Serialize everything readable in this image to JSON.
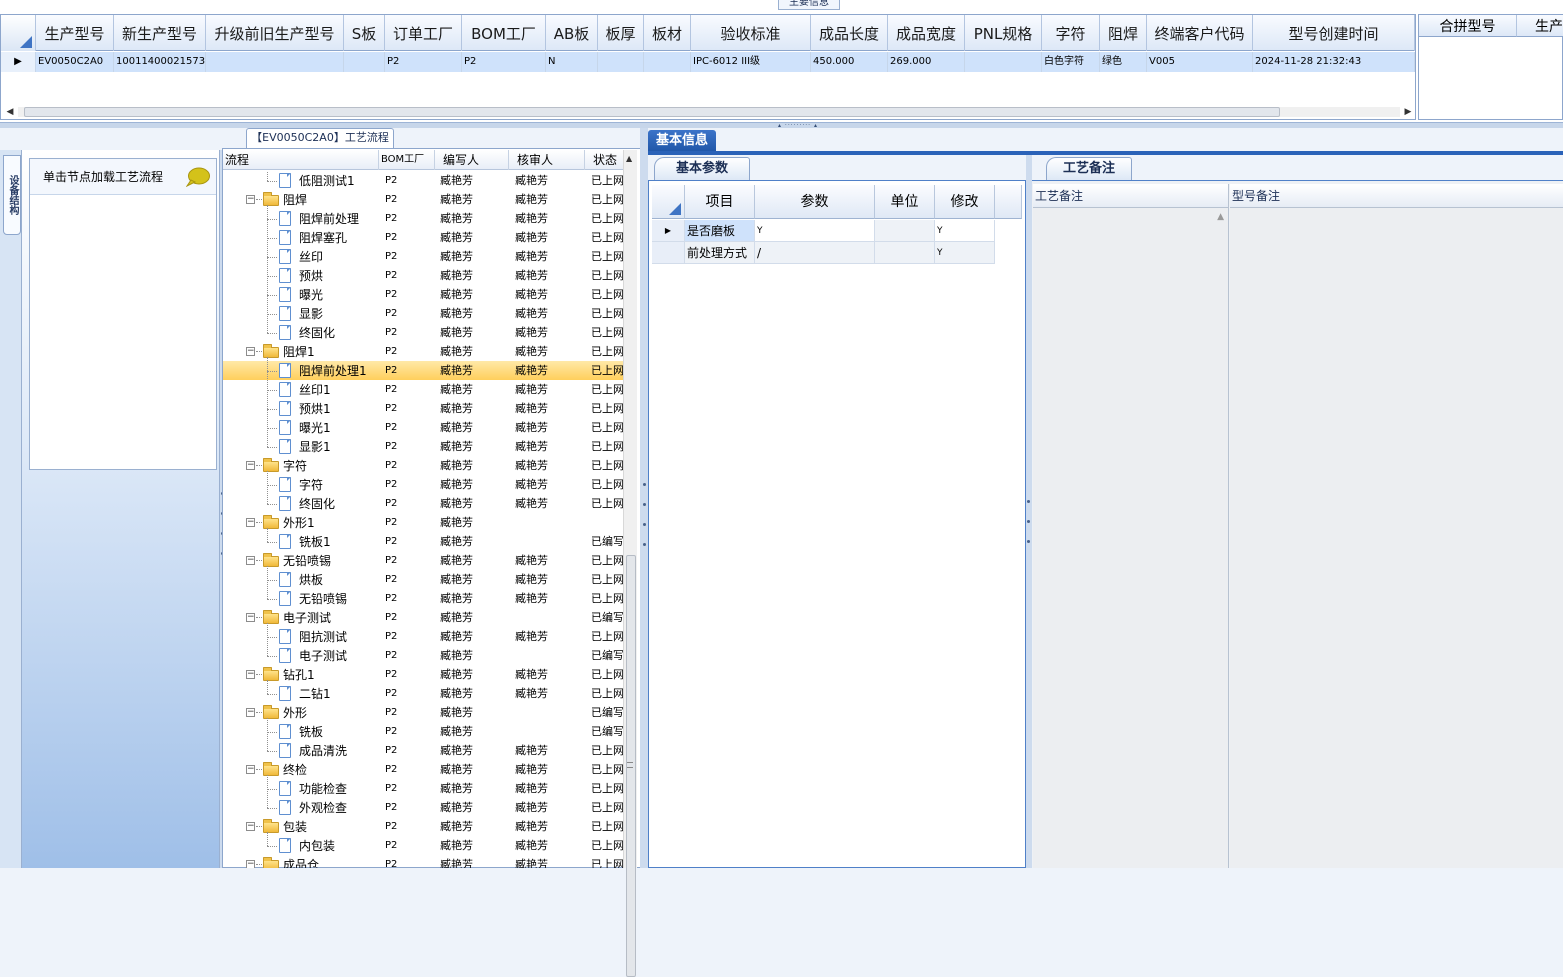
{
  "top_panel": {
    "title_tab": "主要信息",
    "columns": [
      "生产型号",
      "新生产型号",
      "升级前旧生产型号",
      "S板",
      "订单工厂",
      "BOM工厂",
      "AB板",
      "板厚",
      "板材",
      "验收标准",
      "成品长度",
      "成品宽度",
      "PNL规格",
      "字符",
      "阻焊",
      "终端客户代码",
      "型号创建时间"
    ],
    "row": [
      "EV0050C2A0",
      "10011400021573",
      "",
      "",
      "P2",
      "P2",
      "N",
      "",
      "",
      "IPC-6012 III级",
      "450.000",
      "269.000",
      "",
      "白色字符",
      "绿色",
      "V005",
      "2024-11-28 21:32:43"
    ],
    "merge_columns": [
      "合拼型号",
      "生产"
    ]
  },
  "side_tab": {
    "label": "设备结构"
  },
  "hint": {
    "text": "单击节点加载工艺流程"
  },
  "process": {
    "title": "【EV0050C2A0】工艺流程",
    "columns": [
      "流程",
      "BOM工厂",
      "编写人",
      "核审人",
      "状态"
    ],
    "rows": [
      {
        "name": "低阻测试1",
        "level": 1,
        "bom": "P2",
        "writer": "臧艳芳",
        "checker": "臧艳芳",
        "status": "已上网"
      },
      {
        "name": "阻焊",
        "level": 0,
        "bom": "P2",
        "writer": "臧艳芳",
        "checker": "臧艳芳",
        "status": "已上网"
      },
      {
        "name": "阻焊前处理",
        "level": 1,
        "bom": "P2",
        "writer": "臧艳芳",
        "checker": "臧艳芳",
        "status": "已上网"
      },
      {
        "name": "阻焊塞孔",
        "level": 1,
        "bom": "P2",
        "writer": "臧艳芳",
        "checker": "臧艳芳",
        "status": "已上网"
      },
      {
        "name": "丝印",
        "level": 1,
        "bom": "P2",
        "writer": "臧艳芳",
        "checker": "臧艳芳",
        "status": "已上网"
      },
      {
        "name": "预烘",
        "level": 1,
        "bom": "P2",
        "writer": "臧艳芳",
        "checker": "臧艳芳",
        "status": "已上网"
      },
      {
        "name": "曝光",
        "level": 1,
        "bom": "P2",
        "writer": "臧艳芳",
        "checker": "臧艳芳",
        "status": "已上网"
      },
      {
        "name": "显影",
        "level": 1,
        "bom": "P2",
        "writer": "臧艳芳",
        "checker": "臧艳芳",
        "status": "已上网"
      },
      {
        "name": "终固化",
        "level": 1,
        "bom": "P2",
        "writer": "臧艳芳",
        "checker": "臧艳芳",
        "status": "已上网"
      },
      {
        "name": "阻焊1",
        "level": 0,
        "bom": "P2",
        "writer": "臧艳芳",
        "checker": "臧艳芳",
        "status": "已上网"
      },
      {
        "name": "阻焊前处理1",
        "level": 1,
        "bom": "P2",
        "writer": "臧艳芳",
        "checker": "臧艳芳",
        "status": "已上网",
        "selected": true
      },
      {
        "name": "丝印1",
        "level": 1,
        "bom": "P2",
        "writer": "臧艳芳",
        "checker": "臧艳芳",
        "status": "已上网"
      },
      {
        "name": "预烘1",
        "level": 1,
        "bom": "P2",
        "writer": "臧艳芳",
        "checker": "臧艳芳",
        "status": "已上网"
      },
      {
        "name": "曝光1",
        "level": 1,
        "bom": "P2",
        "writer": "臧艳芳",
        "checker": "臧艳芳",
        "status": "已上网"
      },
      {
        "name": "显影1",
        "level": 1,
        "bom": "P2",
        "writer": "臧艳芳",
        "checker": "臧艳芳",
        "status": "已上网"
      },
      {
        "name": "字符",
        "level": 0,
        "bom": "P2",
        "writer": "臧艳芳",
        "checker": "臧艳芳",
        "status": "已上网"
      },
      {
        "name": "字符",
        "level": 1,
        "bom": "P2",
        "writer": "臧艳芳",
        "checker": "臧艳芳",
        "status": "已上网"
      },
      {
        "name": "终固化",
        "level": 1,
        "bom": "P2",
        "writer": "臧艳芳",
        "checker": "臧艳芳",
        "status": "已上网"
      },
      {
        "name": "外形1",
        "level": 0,
        "bom": "P2",
        "writer": "臧艳芳",
        "checker": "",
        "status": ""
      },
      {
        "name": "铣板1",
        "level": 1,
        "bom": "P2",
        "writer": "臧艳芳",
        "checker": "",
        "status": "已编写"
      },
      {
        "name": "无铅喷锡",
        "level": 0,
        "bom": "P2",
        "writer": "臧艳芳",
        "checker": "臧艳芳",
        "status": "已上网"
      },
      {
        "name": "烘板",
        "level": 1,
        "bom": "P2",
        "writer": "臧艳芳",
        "checker": "臧艳芳",
        "status": "已上网"
      },
      {
        "name": "无铅喷锡",
        "level": 1,
        "bom": "P2",
        "writer": "臧艳芳",
        "checker": "臧艳芳",
        "status": "已上网"
      },
      {
        "name": "电子测试",
        "level": 0,
        "bom": "P2",
        "writer": "臧艳芳",
        "checker": "",
        "status": "已编写"
      },
      {
        "name": "阻抗测试",
        "level": 1,
        "bom": "P2",
        "writer": "臧艳芳",
        "checker": "臧艳芳",
        "status": "已上网"
      },
      {
        "name": "电子测试",
        "level": 1,
        "bom": "P2",
        "writer": "臧艳芳",
        "checker": "",
        "status": "已编写"
      },
      {
        "name": "钻孔1",
        "level": 0,
        "bom": "P2",
        "writer": "臧艳芳",
        "checker": "臧艳芳",
        "status": "已上网"
      },
      {
        "name": "二钻1",
        "level": 1,
        "bom": "P2",
        "writer": "臧艳芳",
        "checker": "臧艳芳",
        "status": "已上网"
      },
      {
        "name": "外形",
        "level": 0,
        "bom": "P2",
        "writer": "臧艳芳",
        "checker": "",
        "status": "已编写"
      },
      {
        "name": "铣板",
        "level": 1,
        "bom": "P2",
        "writer": "臧艳芳",
        "checker": "",
        "status": "已编写"
      },
      {
        "name": "成品清洗",
        "level": 1,
        "bom": "P2",
        "writer": "臧艳芳",
        "checker": "臧艳芳",
        "status": "已上网"
      },
      {
        "name": "终检",
        "level": 0,
        "bom": "P2",
        "writer": "臧艳芳",
        "checker": "臧艳芳",
        "status": "已上网"
      },
      {
        "name": "功能检查",
        "level": 1,
        "bom": "P2",
        "writer": "臧艳芳",
        "checker": "臧艳芳",
        "status": "已上网"
      },
      {
        "name": "外观检查",
        "level": 1,
        "bom": "P2",
        "writer": "臧艳芳",
        "checker": "臧艳芳",
        "status": "已上网"
      },
      {
        "name": "包装",
        "level": 0,
        "bom": "P2",
        "writer": "臧艳芳",
        "checker": "臧艳芳",
        "status": "已上网"
      },
      {
        "name": "内包装",
        "level": 1,
        "bom": "P2",
        "writer": "臧艳芳",
        "checker": "臧艳芳",
        "status": "已上网"
      },
      {
        "name": "成品仓",
        "level": 0,
        "bom": "P2",
        "writer": "臧艳芳",
        "checker": "臧艳芳",
        "status": "已上网"
      }
    ]
  },
  "basic_info": {
    "tab": "基本信息",
    "params_tab": "基本参数",
    "columns": [
      "项目",
      "参数",
      "单位",
      "修改"
    ],
    "rows": [
      {
        "item": "是否磨板",
        "param": "Y",
        "unit": "",
        "modify": "Y"
      },
      {
        "item": "前处理方式",
        "param": "/",
        "unit": "",
        "modify": "Y"
      }
    ]
  },
  "remark": {
    "tab": "工艺备注",
    "process_remark": "工艺备注",
    "model_remark": "型号备注"
  },
  "colors": {
    "accent": "#2a62b8",
    "selected_row": "#ffcf5c",
    "grid_row": "#cfe2fb"
  }
}
